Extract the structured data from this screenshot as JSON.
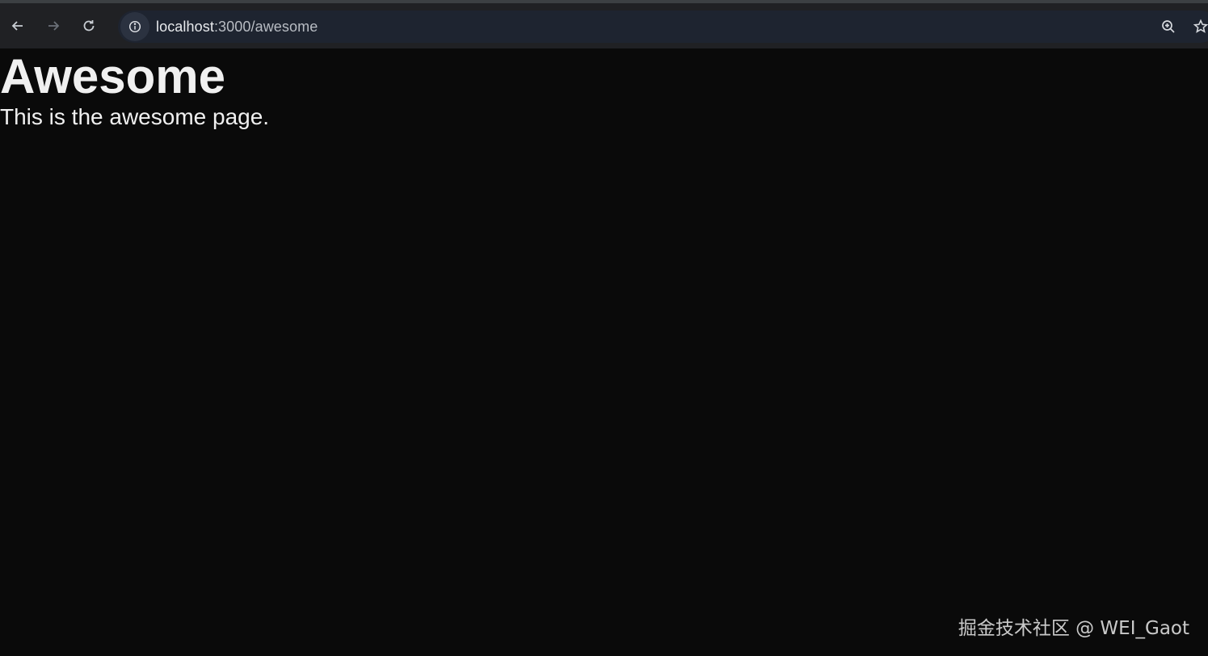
{
  "browser": {
    "back_icon": "arrow-left-icon",
    "forward_icon": "arrow-right-icon",
    "reload_icon": "reload-icon",
    "site_info_icon": "info-icon",
    "url_host": "localhost",
    "url_path": ":3000/awesome",
    "zoom_icon": "zoom-in-icon",
    "bookmark_icon": "star-icon"
  },
  "page": {
    "heading": "Awesome",
    "description": "This is the awesome page."
  },
  "watermark": {
    "text": "掘金技术社区 @ WEI_Gaot"
  },
  "colors": {
    "page_background": "#0a0a0a",
    "toolbar_background": "#202124",
    "omnibox_background": "#1e2430",
    "text": "#f0f0f0"
  }
}
